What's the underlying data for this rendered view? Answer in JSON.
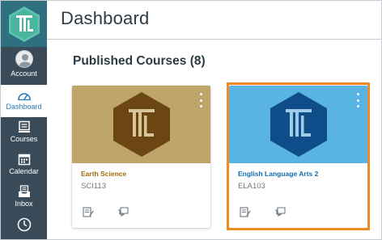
{
  "header": {
    "title": "Dashboard"
  },
  "nav": {
    "items": [
      {
        "label": "Account"
      },
      {
        "label": "Dashboard"
      },
      {
        "label": "Courses"
      },
      {
        "label": "Calendar"
      },
      {
        "label": "Inbox"
      }
    ]
  },
  "section": {
    "title": "Published Courses (8)"
  },
  "courses": [
    {
      "name": "Earth Science",
      "code": "SCI113",
      "color": "#bfa56a",
      "hex_color": "#6b4512",
      "name_color": "#a56a0c"
    },
    {
      "name": "English Language Arts 2",
      "code": "ELA103",
      "color": "#5ab4e3",
      "hex_color": "#0e4d8a",
      "name_color": "#0f6fb5"
    }
  ],
  "colors": {
    "nav_bg": "#394b58",
    "logo_bg": "#2e6f80",
    "active_nav": "#2b7abc",
    "highlight": "#f08a24"
  },
  "icons": [
    "logo-icon",
    "account-avatar-icon",
    "dashboard-icon",
    "courses-icon",
    "calendar-icon",
    "inbox-icon",
    "history-icon",
    "announcements-icon",
    "discussions-icon",
    "options-icon"
  ]
}
